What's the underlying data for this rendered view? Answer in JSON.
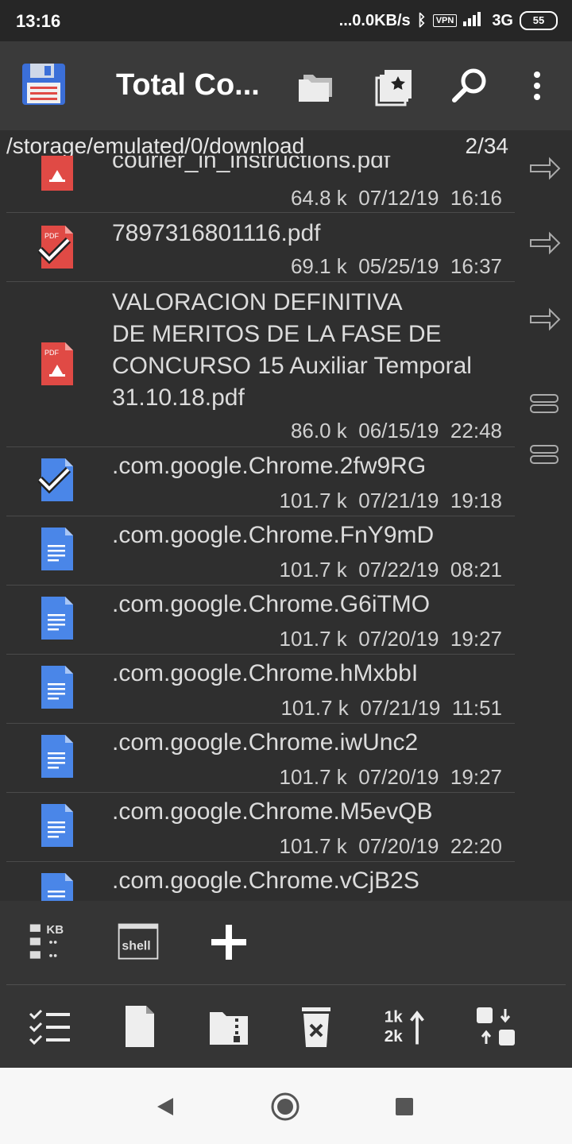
{
  "status_bar": {
    "time": "13:16",
    "network_speed": "...0.0KB/s",
    "vpn_label": "VPN",
    "network_type": "3G",
    "battery": "55"
  },
  "app_bar": {
    "title": "Total Co...",
    "icons": [
      "floppy-disk-icon",
      "folders-icon",
      "bookmark-star-icon",
      "search-icon",
      "more-vert-icon"
    ]
  },
  "path_bar": {
    "path": "/storage/emulated/0/download",
    "count": "2/34"
  },
  "files": [
    {
      "name": "courier_in_instructions.pdf",
      "size": "64.8 k",
      "date": "07/12/19",
      "time": "16:16",
      "type": "pdf",
      "selected": false
    },
    {
      "name": "7897316801116.pdf",
      "size": "69.1 k",
      "date": "05/25/19",
      "time": "16:37",
      "type": "pdf",
      "selected": true
    },
    {
      "name": "VALORACION DEFINITIVA\nDE MERITOS DE LA FASE DE\nCONCURSO 15 Auxiliar Temporal\n31.10.18.pdf",
      "size": "86.0 k",
      "date": "06/15/19",
      "time": "22:48",
      "type": "pdf",
      "selected": false
    },
    {
      "name": ".com.google.Chrome.2fw9RG",
      "size": "101.7 k",
      "date": "07/21/19",
      "time": "19:18",
      "type": "doc",
      "selected": true
    },
    {
      "name": ".com.google.Chrome.FnY9mD",
      "size": "101.7 k",
      "date": "07/22/19",
      "time": "08:21",
      "type": "doc",
      "selected": false
    },
    {
      "name": ".com.google.Chrome.G6iTMO",
      "size": "101.7 k",
      "date": "07/20/19",
      "time": "19:27",
      "type": "doc",
      "selected": false
    },
    {
      "name": ".com.google.Chrome.hMxbbI",
      "size": "101.7 k",
      "date": "07/21/19",
      "time": "11:51",
      "type": "doc",
      "selected": false
    },
    {
      "name": ".com.google.Chrome.iwUnc2",
      "size": "101.7 k",
      "date": "07/20/19",
      "time": "19:27",
      "type": "doc",
      "selected": false
    },
    {
      "name": ".com.google.Chrome.M5evQB",
      "size": "101.7 k",
      "date": "07/20/19",
      "time": "22:20",
      "type": "doc",
      "selected": false
    },
    {
      "name": ".com.google.Chrome.vCjB2S",
      "size": "",
      "date": "",
      "time": "",
      "type": "doc",
      "selected": false
    }
  ],
  "pdf_badge": "PDF",
  "toolbar_top": {
    "kb_label": "KB",
    "shell_label": "shell",
    "icons": [
      "folder-size-icon",
      "shell-icon",
      "add-icon"
    ]
  },
  "toolbar_bottom": {
    "sort_label_top": "1k",
    "sort_label_bottom": "2k",
    "icons": [
      "select-list-icon",
      "new-file-icon",
      "zip-folder-icon",
      "delete-icon",
      "sort-size-icon",
      "swap-panels-icon"
    ]
  },
  "colors": {
    "pdf_red": "#e04a45",
    "doc_blue": "#4a86e8",
    "background": "#2f2f2f",
    "appbar": "#3a3a3a"
  }
}
